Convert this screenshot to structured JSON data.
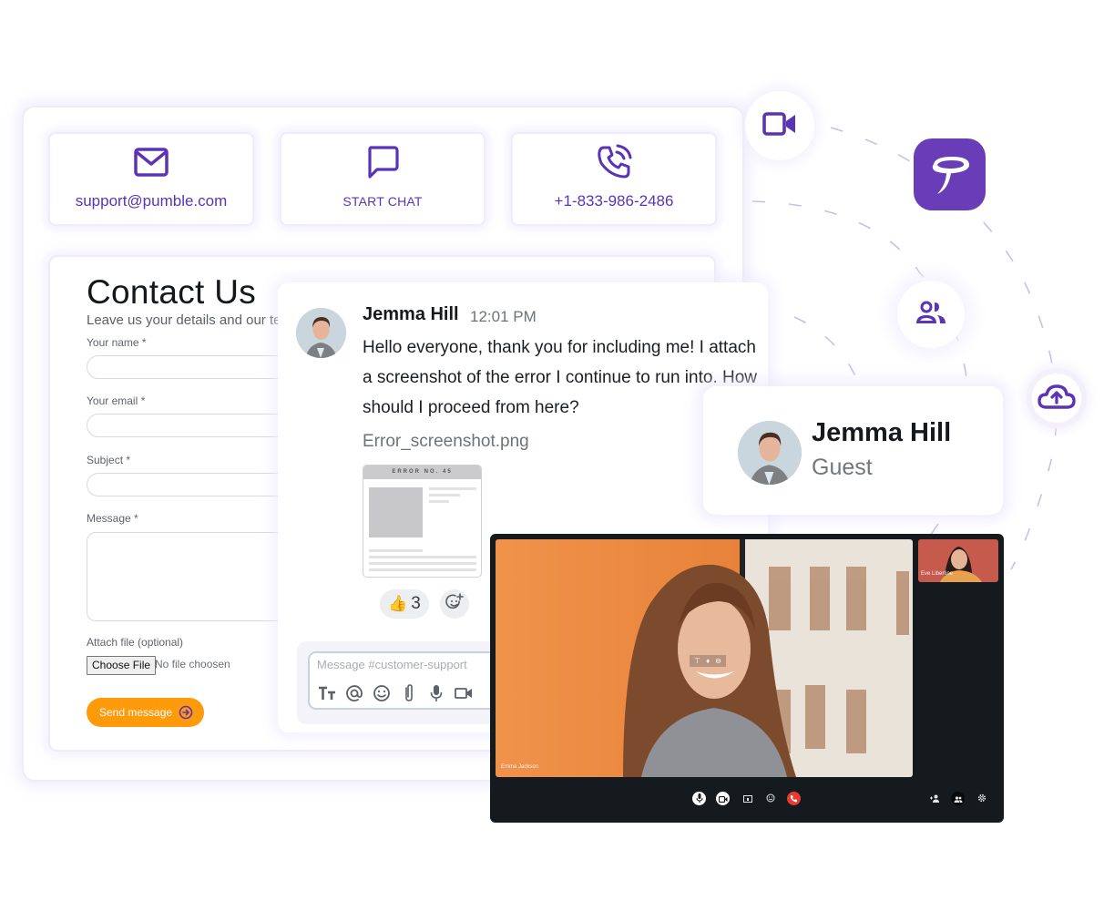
{
  "brand": {
    "name": "Pumble",
    "accent": "#5b34b6",
    "logo_bg": "#6a3db8",
    "cta": "#ff9a0a"
  },
  "contact_tiles": [
    {
      "icon": "mail-icon",
      "label": "support@pumble.com"
    },
    {
      "icon": "chat-bubble-icon",
      "label": "START CHAT"
    },
    {
      "icon": "phone-call-icon",
      "label": "+1-833-986-2486"
    }
  ],
  "form": {
    "title": "Contact Us",
    "subtitle": "Leave us your details and our team will get back to you",
    "fields": [
      {
        "label": "Your name *",
        "value": "",
        "placeholder": ""
      },
      {
        "label": "Your email *",
        "value": "",
        "placeholder": ""
      },
      {
        "label": "Subject *",
        "value": "",
        "placeholder": ""
      }
    ],
    "message_label": "Message *",
    "message_value": "",
    "attach_label": "Attach file (optional)",
    "choose_file": "Choose File",
    "file_status": "No file choosen",
    "send_label": "Send message"
  },
  "chat": {
    "author": "Jemma Hill",
    "time": "12:01 PM",
    "text": "Hello everyone, thank you for including me! I attach a screenshot of the error I continue to run into. How should I proceed from here?",
    "attachment_name": "Error_screenshot.png",
    "attachment_preview_title": "ERROR NO. 45",
    "reactions": [
      {
        "emoji": "👍",
        "count": "3"
      }
    ],
    "add_reaction_icon": "add-emoji-icon",
    "composer_placeholder": "Message #customer-support",
    "composer_tools": [
      "text-format-icon",
      "mention-icon",
      "emoji-icon",
      "attach-icon",
      "mic-icon",
      "video-icon"
    ]
  },
  "profile": {
    "name": "Jemma Hill",
    "role": "Guest"
  },
  "video_call": {
    "main_participant": "Emma Jackson",
    "side_participant": "Eve Libertine",
    "controls": [
      "mic-icon",
      "camera-icon",
      "screen-share-icon",
      "emoji-icon",
      "hang-up-icon"
    ],
    "right_controls": [
      "add-person-icon",
      "participants-icon",
      "settings-icon"
    ],
    "overlay_controls": [
      "pin-icon",
      "mic-icon",
      "minus-circle-icon"
    ],
    "hangup_color": "#ea3b2e"
  },
  "floating_icons": [
    "video-camera-icon",
    "people-icon",
    "cloud-upload-icon"
  ]
}
